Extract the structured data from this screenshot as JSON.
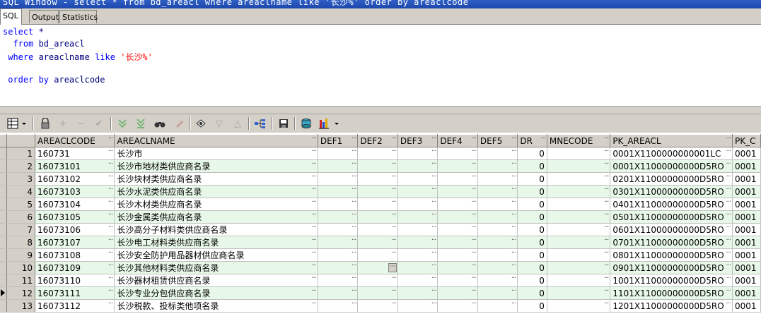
{
  "window": {
    "title": "SQL Window - select * from bd_areacl where areaclname like '长沙%' order by areaclcode"
  },
  "tabs": [
    {
      "label": "SQL"
    },
    {
      "label": "Output"
    },
    {
      "label": "Statistics"
    }
  ],
  "editor": {
    "line1_kw": "select",
    "line1_rest": " *",
    "line2_kw": "from",
    "line2_rest": " bd_areacl",
    "line3_kw": "where",
    "line3_id": " areaclname ",
    "line3_kw2": "like",
    "line3_str": " '长沙%'",
    "line5_kw": "order by",
    "line5_rest": " areaclcode"
  },
  "toolbar": {
    "icons": [
      "grid-options-icon",
      "lock-icon",
      "add-record-icon",
      "delete-record-icon",
      "post-record-icon",
      "next-page-icon",
      "last-page-icon",
      "find-icon",
      "clear-icon",
      "query-by-example-icon",
      "filter-down-icon",
      "filter-up-icon",
      "export-tree-icon",
      "save-icon",
      "print-icon",
      "chart-icon"
    ]
  },
  "grid": {
    "columns": [
      "AREACLCODE",
      "AREACLNAME",
      "DEF1",
      "DEF2",
      "DEF3",
      "DEF4",
      "DEF5",
      "DR",
      "MNECODE",
      "PK_AREACL",
      "PK_C"
    ],
    "rows": [
      {
        "n": "1",
        "code": "160731",
        "name": "长沙市",
        "dr": "0",
        "pk": "0001X1100000000001LC",
        "pkc": "0001"
      },
      {
        "n": "2",
        "code": "16073101",
        "name": "长沙市地材类供应商名录",
        "dr": "0",
        "pk": "0001X11000000000D5RO",
        "pkc": "0001"
      },
      {
        "n": "3",
        "code": "16073102",
        "name": "长沙块材类供应商名录",
        "dr": "0",
        "pk": "0201X11000000000D5RO",
        "pkc": "0001"
      },
      {
        "n": "4",
        "code": "16073103",
        "name": "长沙水泥类供应商名录",
        "dr": "0",
        "pk": "0301X11000000000D5RO",
        "pkc": "0001"
      },
      {
        "n": "5",
        "code": "16073104",
        "name": "长沙木材类供应商名录",
        "dr": "0",
        "pk": "0401X11000000000D5RO",
        "pkc": "0001"
      },
      {
        "n": "6",
        "code": "16073105",
        "name": "长沙金属类供应商名录",
        "dr": "0",
        "pk": "0501X11000000000D5RO",
        "pkc": "0001"
      },
      {
        "n": "7",
        "code": "16073106",
        "name": "长沙高分子材料类供应商名录",
        "dr": "0",
        "pk": "0601X11000000000D5RO",
        "pkc": "0001"
      },
      {
        "n": "8",
        "code": "16073107",
        "name": "长沙电工材料类供应商名录",
        "dr": "0",
        "pk": "0701X11000000000D5RO",
        "pkc": "0001"
      },
      {
        "n": "9",
        "code": "16073108",
        "name": "长沙安全防护用品器材供应商名录",
        "dr": "0",
        "pk": "0801X11000000000D5RO",
        "pkc": "0001"
      },
      {
        "n": "10",
        "code": "16073109",
        "name": "长沙其他材料类供应商名录",
        "dr": "0",
        "pk": "0901X11000000000D5RO",
        "pkc": "0001"
      },
      {
        "n": "11",
        "code": "16073110",
        "name": "长沙器材租赁供应商名录",
        "dr": "0",
        "pk": "1001X11000000000D5RO",
        "pkc": "0001"
      },
      {
        "n": "12",
        "code": "16073111",
        "name": "长沙专业分包供应商名录",
        "dr": "0",
        "pk": "1101X11000000000D5RO",
        "pkc": "0001"
      },
      {
        "n": "13",
        "code": "16073112",
        "name": "长沙税款、投标类他项名录",
        "dr": "0",
        "pk": "1201X11000000000D5RO",
        "pkc": "0001"
      }
    ],
    "current_row_index": 11
  }
}
